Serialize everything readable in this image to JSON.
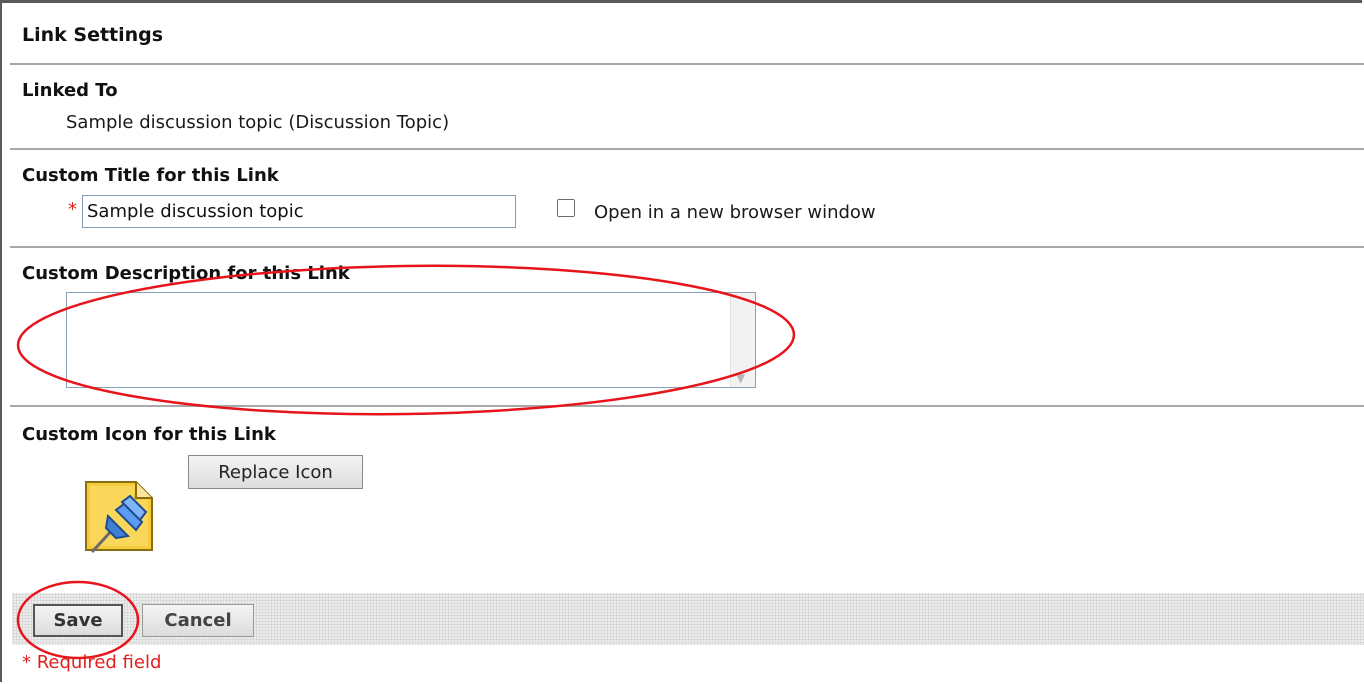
{
  "header": {
    "title": "Link Settings"
  },
  "linked_to": {
    "heading": "Linked To",
    "value": "Sample discussion topic (Discussion Topic)"
  },
  "custom_title": {
    "heading": "Custom Title for this Link",
    "required_marker": "*",
    "value": "Sample discussion topic",
    "checkbox_label": "Open in a new browser window",
    "checkbox_checked": false
  },
  "custom_description": {
    "heading": "Custom Description for this Link",
    "value": ""
  },
  "custom_icon": {
    "heading": "Custom Icon for this Link",
    "icon_name": "pushpin-document-icon",
    "replace_label": "Replace Icon"
  },
  "actions": {
    "save_label": "Save",
    "cancel_label": "Cancel",
    "required_note": "* Required field"
  },
  "colors": {
    "required": "#e0201e",
    "annotation": "#e8141c",
    "separator": "#a8a8a8"
  }
}
